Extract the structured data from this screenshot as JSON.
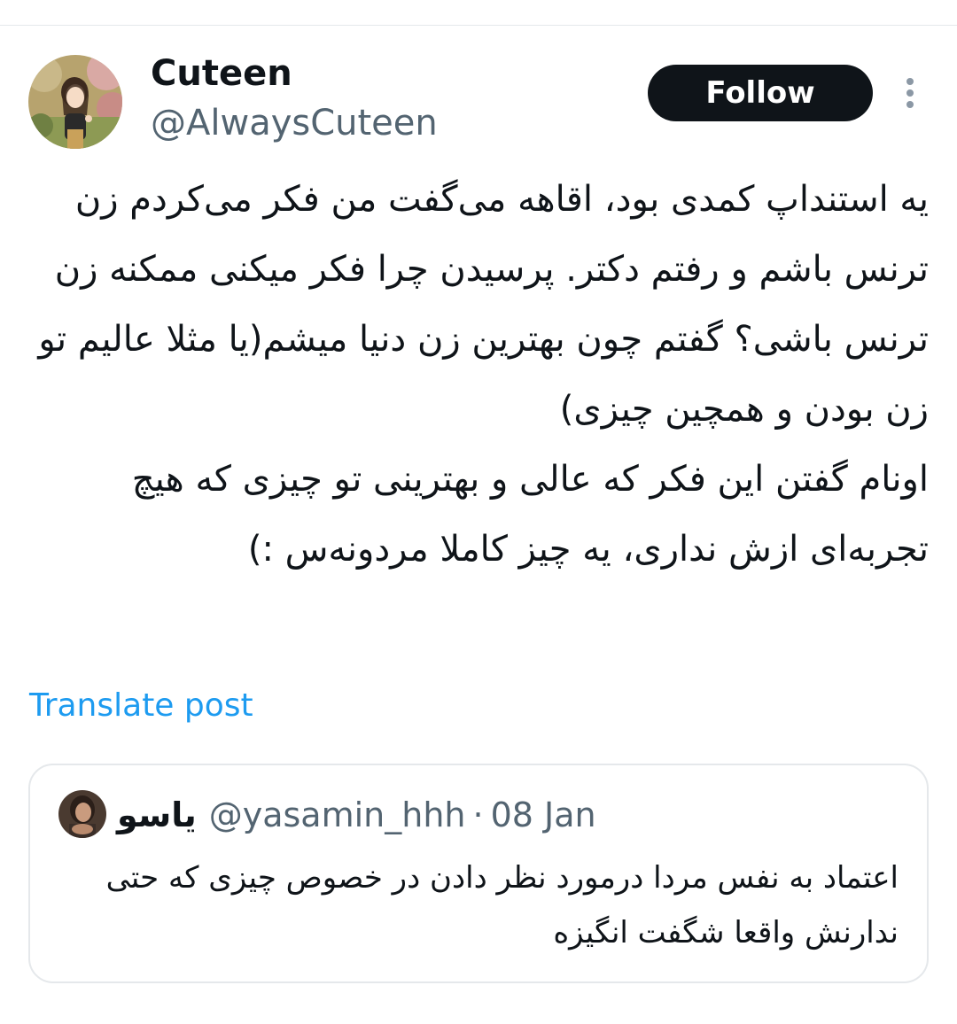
{
  "author": {
    "display_name": "Cuteen",
    "handle": "@AlwaysCuteen",
    "avatar_icon": "profile-avatar-illustration"
  },
  "actions": {
    "follow_label": "Follow",
    "more_icon": "more-vertical-icon"
  },
  "tweet": {
    "paragraphs": [
      "یه استنداپ کمدی بود، اقاهه می‌گفت من فکر می‌کردم زن ترنس باشم و رفتم دکتر. پرسیدن چرا فکر میکنی ممکنه زن ترنس باشی؟ گفتم چون بهترین زن دنیا میشم(یا مثلا عالیم تو زن بودن و همچین چیزی)",
      "اونام گفتن این فکر که عالی و بهترینی تو چیزی که هیچ تجربه‌ای ازش نداری، یه چیز کاملا مردونه‌س :)"
    ],
    "translate_label": "Translate post"
  },
  "quoted_tweet": {
    "display_name": "یاسو",
    "handle": "@yasamin_hhh",
    "separator": "·",
    "date": "08 Jan",
    "text": "اعتماد به نفس مردا درمورد نظر دادن در خصوص چیزی که حتی ندارنش واقعا شگفت انگیزه",
    "avatar_icon": "quoted-profile-avatar"
  },
  "colors": {
    "text_primary": "#0f1419",
    "text_secondary": "#536471",
    "link": "#1d9bf0",
    "border": "#e5e8eb",
    "follow_bg": "#0f1419"
  }
}
